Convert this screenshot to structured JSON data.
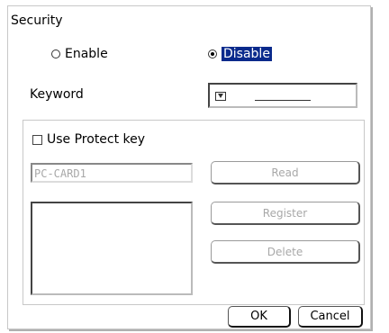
{
  "dialog": {
    "title": "Security",
    "enable_label": "Enable",
    "disable_label": "Disable",
    "selected": "Disable",
    "keyword_label": "Keyword",
    "protect_key": {
      "label": "Use Protect key",
      "checked": false,
      "card_field_value": "PC-CARD1",
      "read_label": "Read",
      "register_label": "Register",
      "delete_label": "Delete"
    },
    "ok_label": "OK",
    "cancel_label": "Cancel"
  },
  "colors": {
    "selection_highlight": "#0a2a8c",
    "disabled_text": "#a8a8a8"
  }
}
